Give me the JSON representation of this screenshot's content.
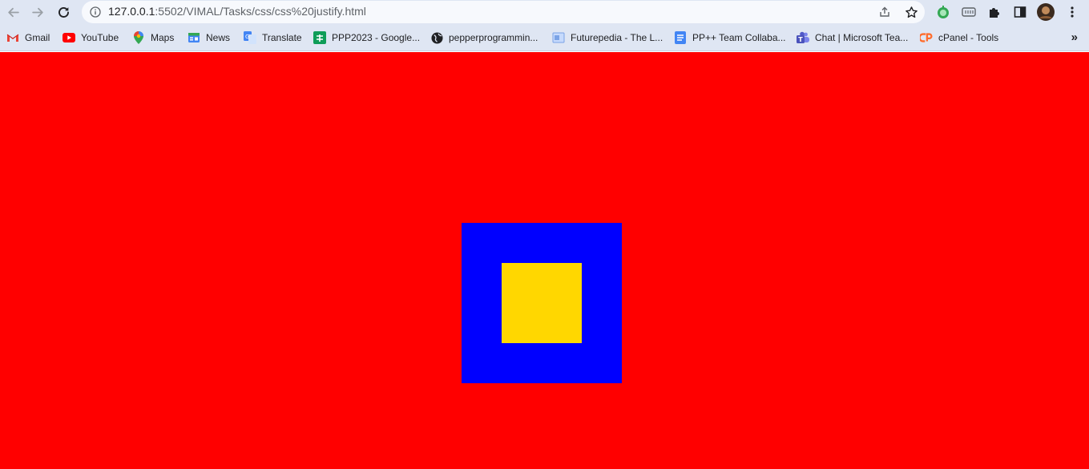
{
  "browser": {
    "url_host": "127.0.0.1",
    "url_rest": ":5502/VIMAL/Tasks/css/css%20justify.html",
    "bookmarks": [
      {
        "label": "Gmail",
        "icon": "gmail-icon"
      },
      {
        "label": "YouTube",
        "icon": "youtube-icon"
      },
      {
        "label": "Maps",
        "icon": "maps-icon"
      },
      {
        "label": "News",
        "icon": "news-icon"
      },
      {
        "label": "Translate",
        "icon": "translate-icon"
      },
      {
        "label": "PPP2023 - Google...",
        "icon": "sheets-icon"
      },
      {
        "label": "pepperprogrammin...",
        "icon": "globe-icon"
      },
      {
        "label": "Futurepedia - The L...",
        "icon": "futurepedia-icon"
      },
      {
        "label": "PP++ Team Collaba...",
        "icon": "docs-icon"
      },
      {
        "label": "Chat | Microsoft Tea...",
        "icon": "teams-icon"
      },
      {
        "label": "cPanel - Tools",
        "icon": "cpanel-icon"
      }
    ],
    "more_bookmarks_label": "»"
  },
  "page": {
    "background_color": "#ff0000",
    "outer_box_color": "#0000ff",
    "inner_box_color": "#ffd700"
  }
}
